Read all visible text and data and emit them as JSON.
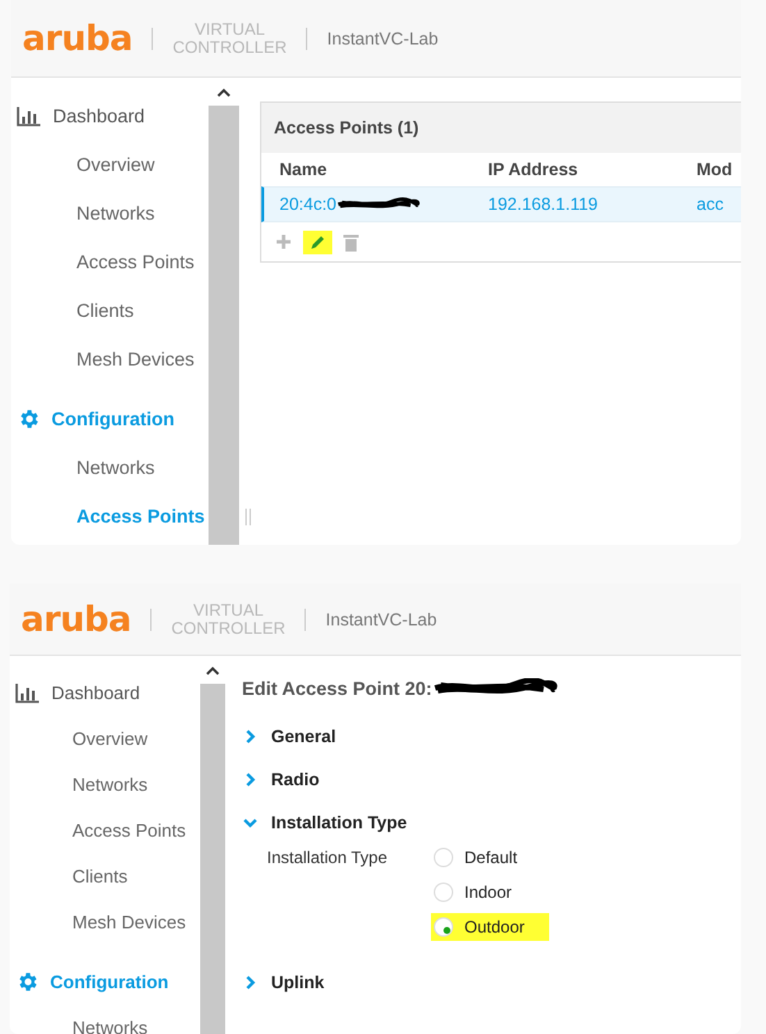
{
  "screens": [
    {
      "header": {
        "logo": "aruba",
        "product": [
          "VIRTUAL",
          "CONTROLLER"
        ],
        "name": "InstantVC-Lab"
      },
      "sidebar": {
        "sections": [
          {
            "label": "Dashboard",
            "selected": false,
            "children": [
              {
                "label": "Overview",
                "selected": false
              },
              {
                "label": "Networks",
                "selected": false
              },
              {
                "label": "Access Points",
                "selected": false
              },
              {
                "label": "Clients",
                "selected": false
              },
              {
                "label": "Mesh Devices",
                "selected": false
              }
            ]
          },
          {
            "label": "Configuration",
            "selected": true,
            "children": [
              {
                "label": "Networks",
                "selected": false
              },
              {
                "label": "Access Points",
                "selected": true
              }
            ]
          }
        ]
      },
      "content": {
        "kind": "table",
        "title": "Access Points (1)",
        "columns": [
          "Name",
          "IP Address",
          "Mod"
        ],
        "rows": [
          {
            "cells": [
              "20:4c:0",
              "192.168.1.119",
              "acc"
            ],
            "selected": true,
            "redacted": true
          }
        ],
        "actions": [
          {
            "kind": "add",
            "highlighted": false
          },
          {
            "kind": "edit",
            "highlighted": true
          },
          {
            "kind": "delete",
            "highlighted": false
          }
        ]
      }
    },
    {
      "header": {
        "logo": "aruba",
        "product": [
          "VIRTUAL",
          "CONTROLLER"
        ],
        "name": "InstantVC-Lab"
      },
      "sidebar": {
        "sections": [
          {
            "label": "Dashboard",
            "selected": false,
            "children": [
              {
                "label": "Overview",
                "selected": false
              },
              {
                "label": "Networks",
                "selected": false
              },
              {
                "label": "Access Points",
                "selected": false
              },
              {
                "label": "Clients",
                "selected": false
              },
              {
                "label": "Mesh Devices",
                "selected": false
              }
            ]
          },
          {
            "label": "Configuration",
            "selected": true,
            "children": [
              {
                "label": "Networks",
                "selected": false
              }
            ]
          }
        ]
      },
      "content": {
        "kind": "form",
        "title": "Edit Access Point 20:",
        "redacted": true,
        "sections": [
          {
            "label": "General",
            "expanded": false
          },
          {
            "label": "Radio",
            "expanded": false
          },
          {
            "label": "Installation Type",
            "expanded": true,
            "field": {
              "label": "Installation Type",
              "options": [
                {
                  "label": "Default",
                  "selected": false,
                  "highlighted": false
                },
                {
                  "label": "Indoor",
                  "selected": false,
                  "highlighted": false
                },
                {
                  "label": "Outdoor",
                  "selected": true,
                  "highlighted": true
                }
              ]
            }
          },
          {
            "label": "Uplink",
            "expanded": false
          }
        ]
      }
    }
  ]
}
